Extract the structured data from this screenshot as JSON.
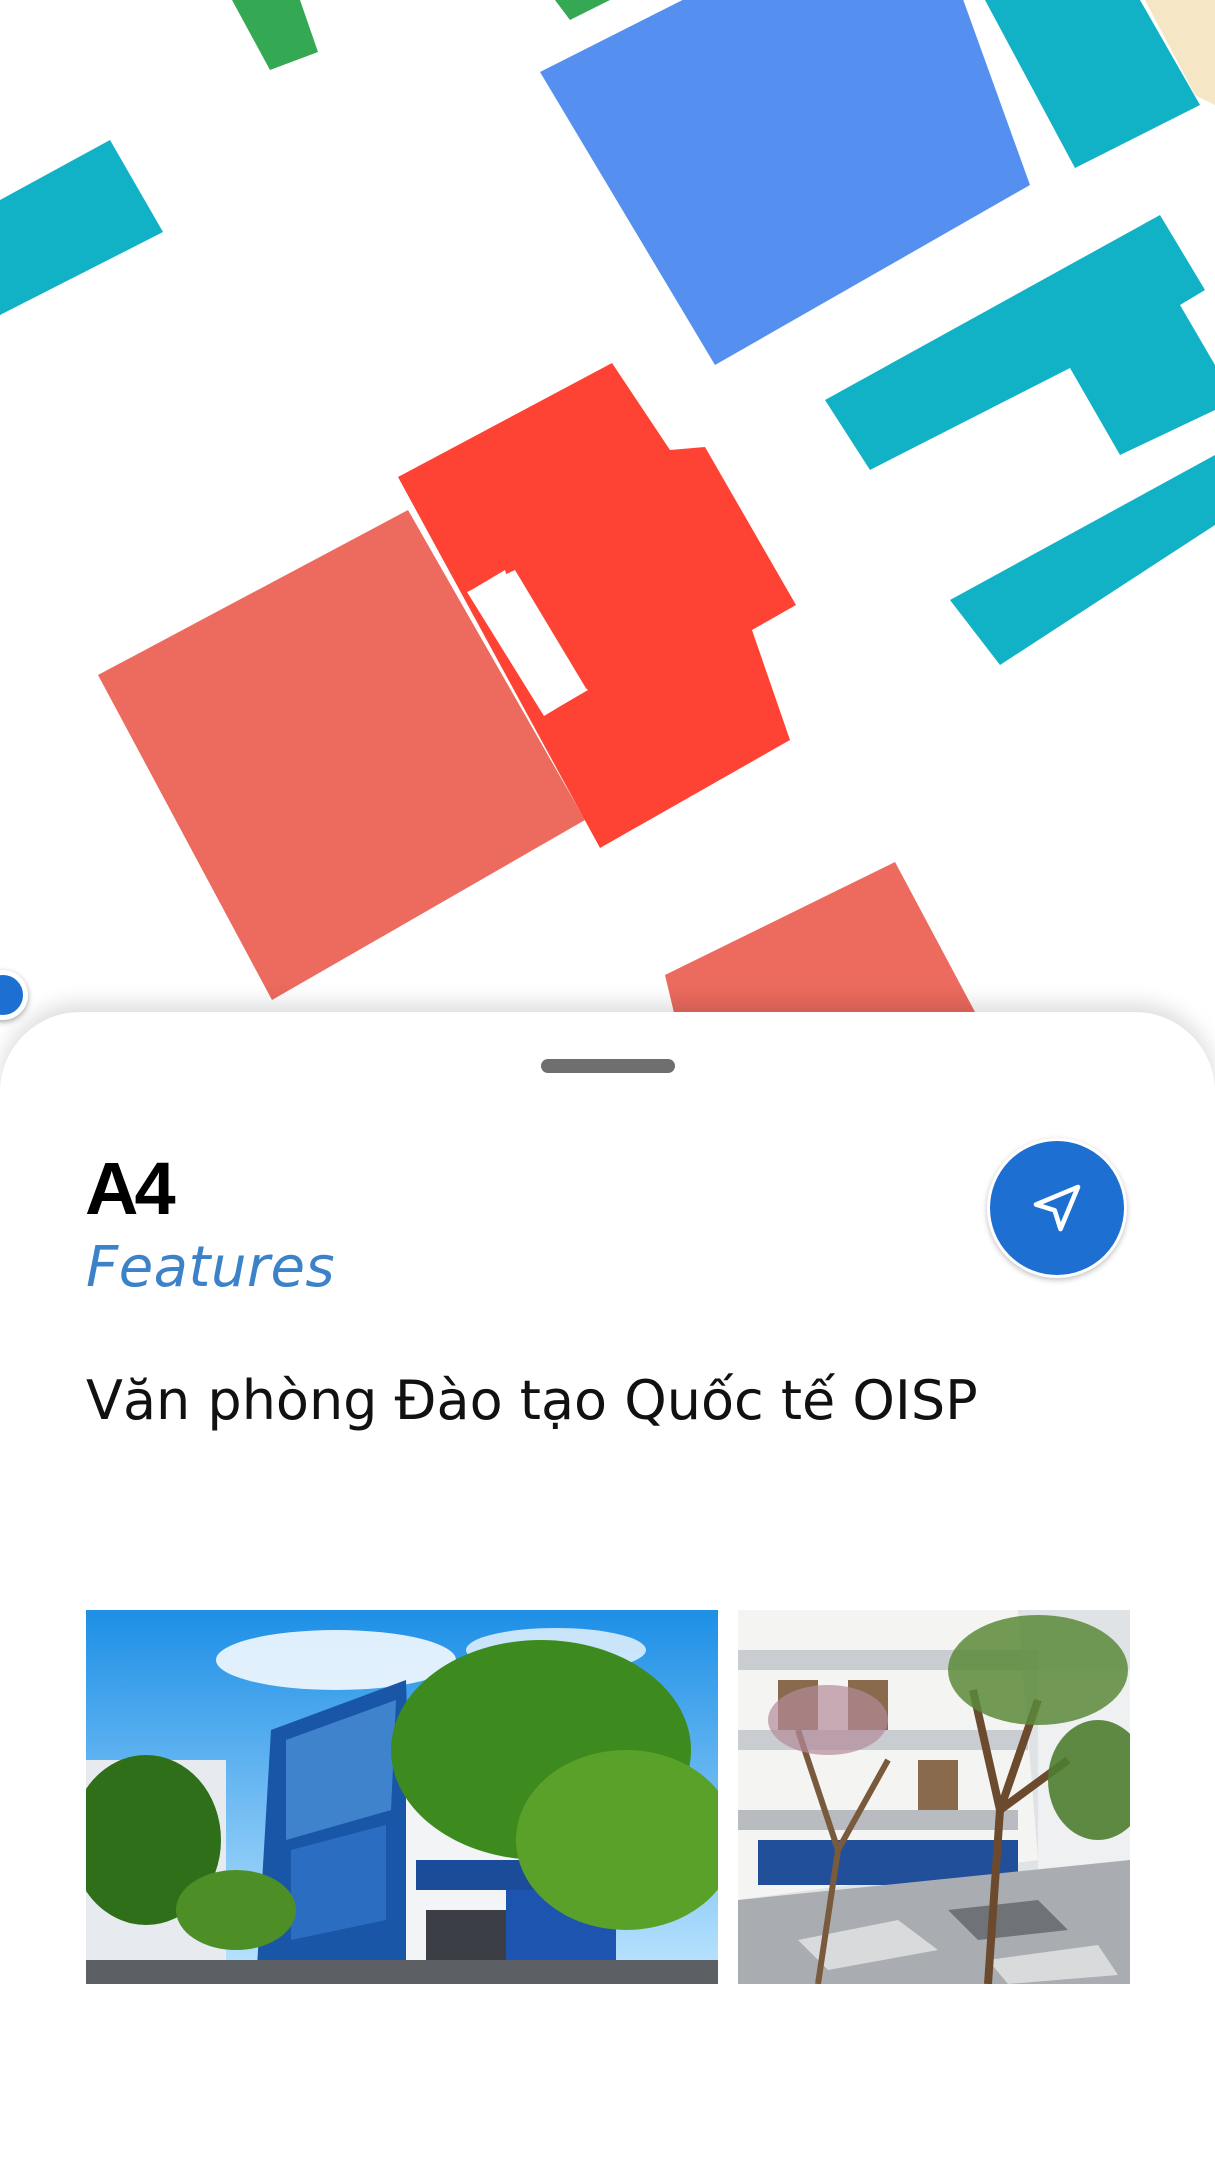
{
  "building": {
    "code": "A4",
    "category": "Features",
    "name": "Văn phòng Đào tạo Quốc tế OISP"
  },
  "icons": {
    "navigate": "navigation-arrow-icon",
    "location": "current-location-dot"
  },
  "colors": {
    "accent": "#1e6fd2",
    "category_text": "#3b82c8",
    "selected_building": "#fe4334",
    "building_red": "#ec6a5e",
    "building_blue": "#5590f0",
    "building_teal": "#12b2c6",
    "building_green": "#34a853",
    "building_sand": "#f5e6c5"
  },
  "gallery": {
    "photos": [
      "building-front-photo",
      "courtyard-photo"
    ]
  }
}
